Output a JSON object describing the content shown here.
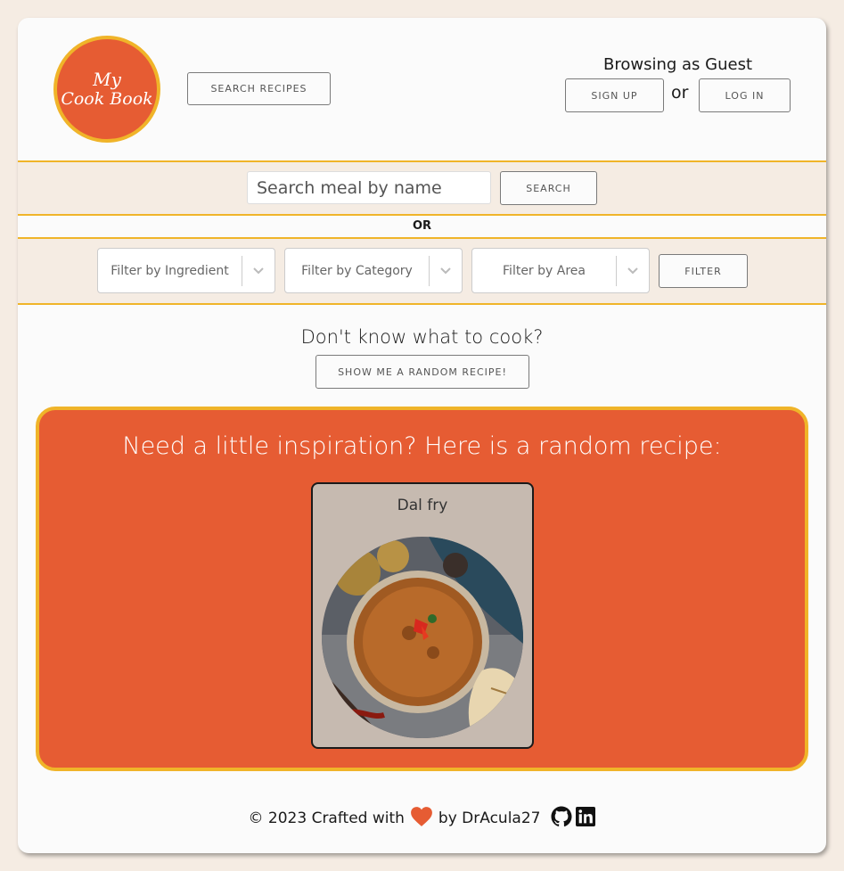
{
  "header": {
    "logo_line1": "My",
    "logo_line2": "Cook Book",
    "search_recipes_label": "Search Recipes",
    "guest_text": "Browsing as Guest",
    "or_text": "or",
    "signup_label": "Sign Up",
    "login_label": "Log In"
  },
  "search": {
    "placeholder": "Search meal by name",
    "button_label": "Search"
  },
  "divider_text": "OR",
  "filters": {
    "ingredient_placeholder": "Filter by Ingredient",
    "category_placeholder": "Filter by Category",
    "area_placeholder": "Filter by Area",
    "filter_button_label": "Filter"
  },
  "random": {
    "question": "Don't know what to cook?",
    "button_label": "Show me a random recipe!",
    "inspiration_title": "Need a little inspiration? Here is a random recipe:",
    "recipe_name": "Dal fry"
  },
  "footer": {
    "copyright": "© 2023 Crafted with",
    "by_text": "by DrAcula27",
    "icons": [
      "heart-icon",
      "github-icon",
      "linkedin-icon"
    ]
  },
  "colors": {
    "accent": "#e65c33",
    "border": "#f0b429",
    "band_bg": "#f5ece3",
    "card_bg": "#fbfbfb",
    "recipe_card_bg": "#c6bab0"
  }
}
